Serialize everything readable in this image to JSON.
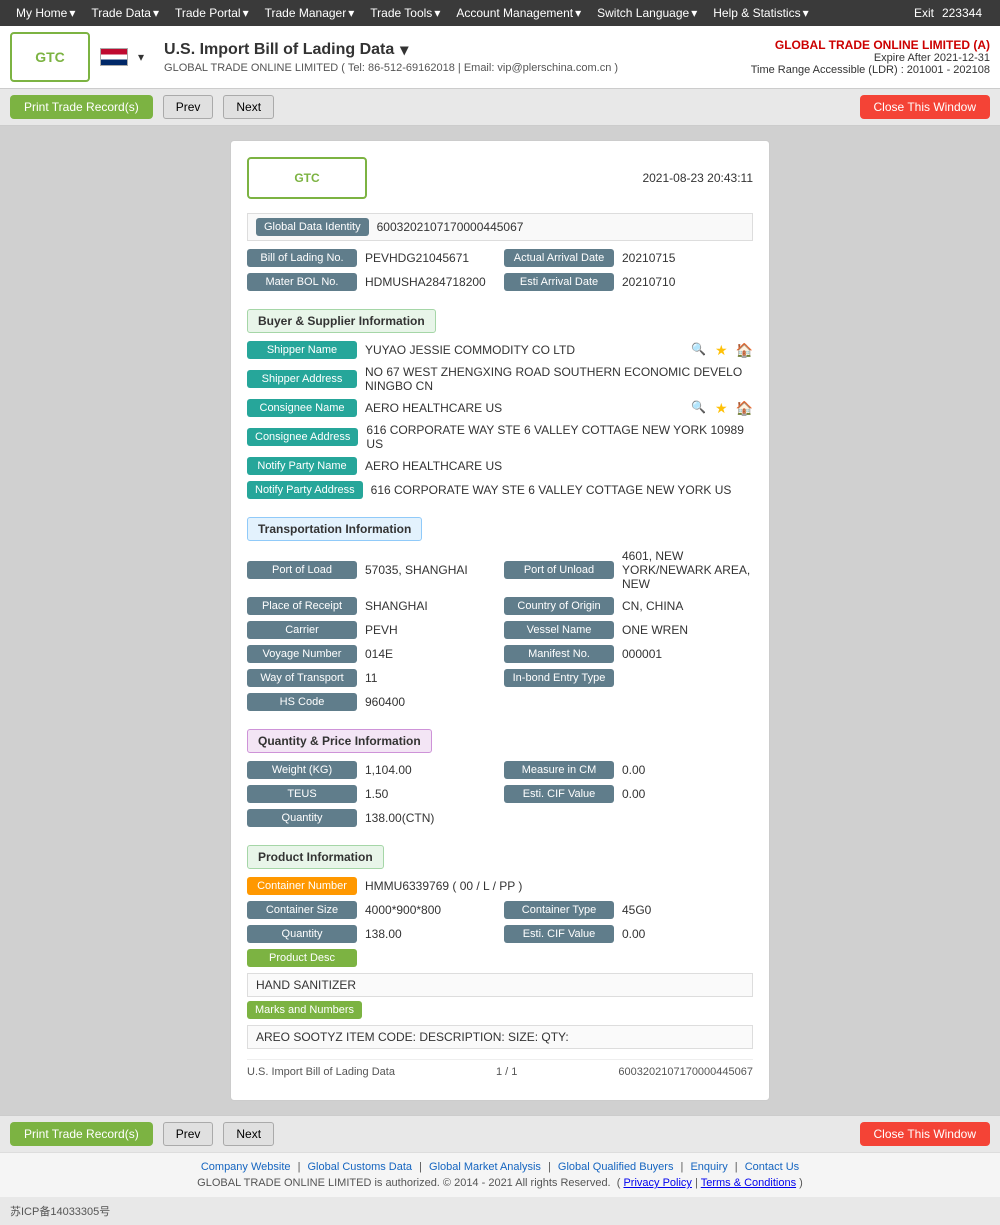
{
  "topnav": {
    "items": [
      "My Home",
      "Trade Data",
      "Trade Portal",
      "Trade Manager",
      "Trade Tools",
      "Account Management",
      "Switch Language",
      "Help & Statistics",
      "Exit"
    ],
    "account_num": "223344"
  },
  "header": {
    "logo_text": "GTC",
    "title": "U.S. Import Bill of Lading Data",
    "subtitle": "GLOBAL TRADE ONLINE LIMITED ( Tel: 86-512-69162018 | Email: vip@plerschina.com.cn )",
    "company_name": "GLOBAL TRADE ONLINE LIMITED (A)",
    "expire": "Expire After 2021-12-31",
    "time_range": "Time Range Accessible (LDR) : 201001 - 202108"
  },
  "toolbar": {
    "print_label": "Print Trade Record(s)",
    "prev_label": "Prev",
    "next_label": "Next",
    "close_label": "Close This Window"
  },
  "panel": {
    "datetime": "2021-08-23 20:43:11",
    "logo_text": "GTC",
    "global_data_id_label": "Global Data Identity",
    "global_data_id_value": "6003202107170000445067",
    "bol_no_label": "Bill of Lading No.",
    "bol_no_value": "PEVHDG21045671",
    "actual_arrival_label": "Actual Arrival Date",
    "actual_arrival_value": "20210715",
    "master_bol_label": "Mater BOL No.",
    "master_bol_value": "HDMUSHA284718200",
    "esti_arrival_label": "Esti Arrival Date",
    "esti_arrival_value": "20210710"
  },
  "buyer_supplier": {
    "section_label": "Buyer & Supplier Information",
    "shipper_name_label": "Shipper Name",
    "shipper_name_value": "YUYAO JESSIE COMMODITY CO LTD",
    "shipper_addr_label": "Shipper Address",
    "shipper_addr_value": "NO 67 WEST ZHENGXING ROAD SOUTHERN ECONOMIC DEVELO NINGBO CN",
    "consignee_name_label": "Consignee Name",
    "consignee_name_value": "AERO HEALTHCARE US",
    "consignee_addr_label": "Consignee Address",
    "consignee_addr_value": "616 CORPORATE WAY STE 6 VALLEY COTTAGE NEW YORK 10989 US",
    "notify_party_name_label": "Notify Party Name",
    "notify_party_name_value": "AERO HEALTHCARE US",
    "notify_party_addr_label": "Notify Party Address",
    "notify_party_addr_value": "616 CORPORATE WAY STE 6 VALLEY COTTAGE NEW YORK US"
  },
  "transportation": {
    "section_label": "Transportation Information",
    "port_load_label": "Port of Load",
    "port_load_value": "57035, SHANGHAI",
    "port_unload_label": "Port of Unload",
    "port_unload_value": "4601, NEW YORK/NEWARK AREA, NEW",
    "place_receipt_label": "Place of Receipt",
    "place_receipt_value": "SHANGHAI",
    "country_origin_label": "Country of Origin",
    "country_origin_value": "CN, CHINA",
    "carrier_label": "Carrier",
    "carrier_value": "PEVH",
    "vessel_name_label": "Vessel Name",
    "vessel_name_value": "ONE WREN",
    "voyage_num_label": "Voyage Number",
    "voyage_num_value": "014E",
    "manifest_label": "Manifest No.",
    "manifest_value": "000001",
    "way_transport_label": "Way of Transport",
    "way_transport_value": "11",
    "inbond_label": "In-bond Entry Type",
    "inbond_value": "",
    "hs_code_label": "HS Code",
    "hs_code_value": "960400"
  },
  "quantity_price": {
    "section_label": "Quantity & Price Information",
    "weight_label": "Weight (KG)",
    "weight_value": "1,104.00",
    "measure_label": "Measure in CM",
    "measure_value": "0.00",
    "teus_label": "TEUS",
    "teus_value": "1.50",
    "esti_cif_label": "Esti. CIF Value",
    "esti_cif_value": "0.00",
    "quantity_label": "Quantity",
    "quantity_value": "138.00(CTN)"
  },
  "product_info": {
    "section_label": "Product Information",
    "container_num_label": "Container Number",
    "container_num_value": "HMMU6339769 ( 00 / L / PP )",
    "container_size_label": "Container Size",
    "container_size_value": "4000*900*800",
    "container_type_label": "Container Type",
    "container_type_value": "45G0",
    "quantity_label": "Quantity",
    "quantity_value": "138.00",
    "esti_cif_label": "Esti. CIF Value",
    "esti_cif_value": "0.00",
    "product_desc_label": "Product Desc",
    "product_desc_value": "HAND SANITIZER",
    "marks_numbers_label": "Marks and Numbers",
    "marks_numbers_value": "AREO SOOTYZ ITEM CODE: DESCRIPTION: SIZE: QTY:"
  },
  "record_footer": {
    "page_info": "1 / 1",
    "record_label": "U.S. Import Bill of Lading Data",
    "record_id": "6003202107170000445067"
  },
  "bottom_toolbar": {
    "print_label": "Print Trade Record(s)",
    "prev_label": "Prev",
    "next_label": "Next",
    "close_label": "Close This Window"
  },
  "footer_links": [
    "Company Website",
    "Global Customs Data",
    "Global Market Analysis",
    "Global Qualified Buyers",
    "Enquiry",
    "Contact Us"
  ],
  "footer_copyright": "GLOBAL TRADE ONLINE LIMITED is authorized. © 2014 - 2021 All rights Reserved.",
  "footer_policy": "Privacy Policy",
  "footer_terms": "Terms & Conditions",
  "icp": "苏ICP备14033305号"
}
